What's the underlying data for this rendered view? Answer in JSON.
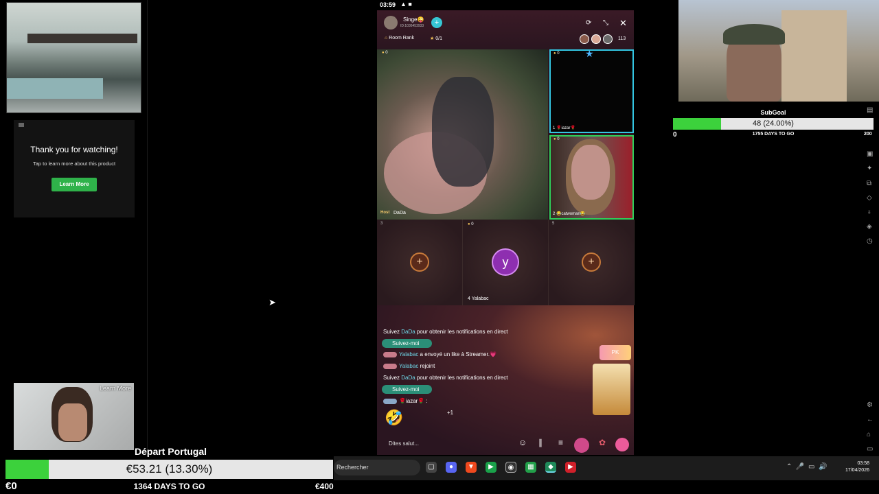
{
  "ad": {
    "thanks": "Thank you for watching!",
    "tap_text": "Tap to learn more about this product",
    "learn_more": "Learn More"
  },
  "small_video": {
    "learn_more": "Learn More"
  },
  "phone": {
    "status_time": "03:59",
    "status_icons": "▲ ■",
    "room_title": "Singe😜",
    "room_id": "ID:1036453933",
    "rank_label": "Room Rank",
    "star_count": "0/1",
    "viewer_count": "113",
    "main_seat": {
      "coins": "0",
      "host_tag": "Host",
      "name": "DaDa"
    },
    "seat1": {
      "coins": "0",
      "name": "1 🌹iazar🌹"
    },
    "seat2": {
      "coins": "0",
      "name": "2 😂catwoman😂"
    },
    "seat3": {
      "number": "3"
    },
    "seat4": {
      "coins": "0",
      "name": "4 Yalabac",
      "avatar_letter": "y"
    },
    "seat5": {
      "number": "5"
    },
    "chat": {
      "line1_prefix": "Suivez ",
      "line1_name": "DaDa",
      "line1_suffix": " pour obtenir les notifications en direct",
      "follow1": "Suivez-moi",
      "line2_name": "Yalabac",
      "line2_text": " a envoyé un like à Streamer.💗",
      "line3_name": "Yalabac",
      "line3_text": " rejoint",
      "line4_prefix": "Suivez ",
      "line4_name": "DaDa",
      "line4_suffix": " pour obtenir les notifications en direct",
      "follow2": "Suivez-moi",
      "line5_text": "🌹iazar🌹 :",
      "emoji": "🤣",
      "plus_one": "+1"
    },
    "pk_badge": "PK",
    "input_placeholder": "Dites salut..."
  },
  "subgoal": {
    "title": "SubGoal",
    "progress_text": "48 (24.00%)",
    "progress_fraction": 0.24,
    "start": "0",
    "days_text": "1755 DAYS TO GO",
    "end": "200"
  },
  "goal": {
    "title": "Départ Portugal",
    "progress_text": "€53.21 (13.30%)",
    "progress_fraction": 0.133,
    "start": "€0",
    "days_text": "1364 DAYS TO GO",
    "end": "€400"
  },
  "taskbar": {
    "search_label": "Rechercher",
    "time": "03:58",
    "date": "17/04/2026"
  },
  "colors": {
    "goal_fill": "#3cd13c",
    "accent_cyan": "#36c6d4",
    "follow_green": "#2b8f78"
  }
}
